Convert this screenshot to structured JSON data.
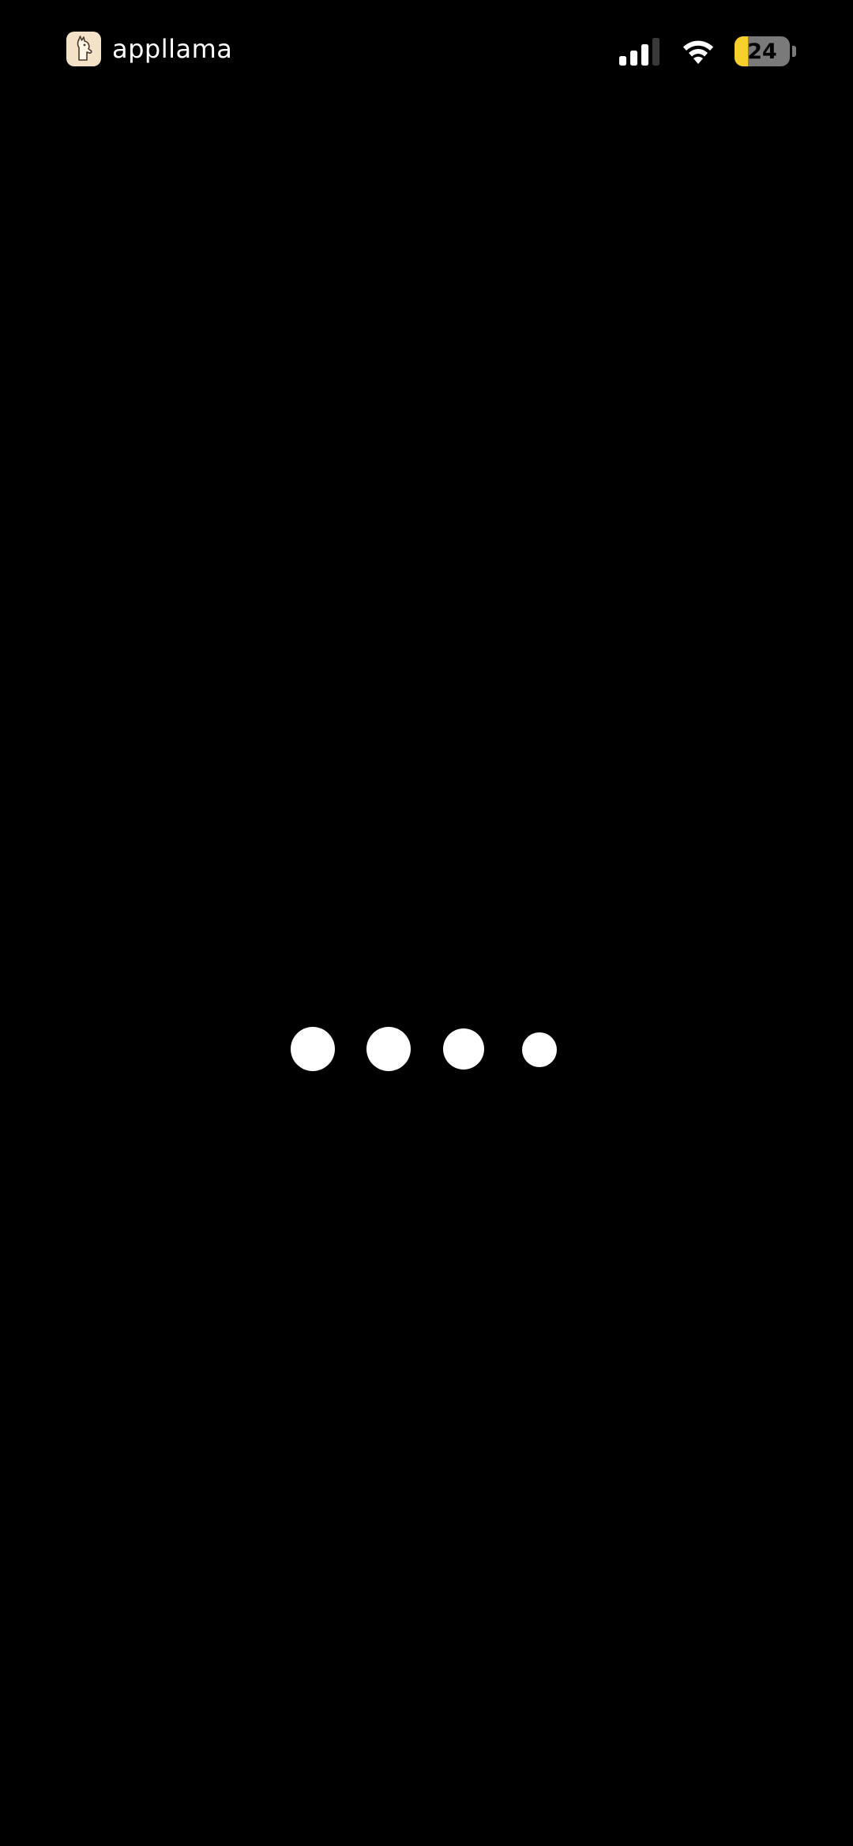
{
  "status_bar": {
    "app_name": "appllama",
    "battery_level": "24",
    "battery_fraction": 0.24,
    "battery_accent": "#f7cf2a"
  },
  "loading_indicator": {
    "dot_count": 4
  }
}
